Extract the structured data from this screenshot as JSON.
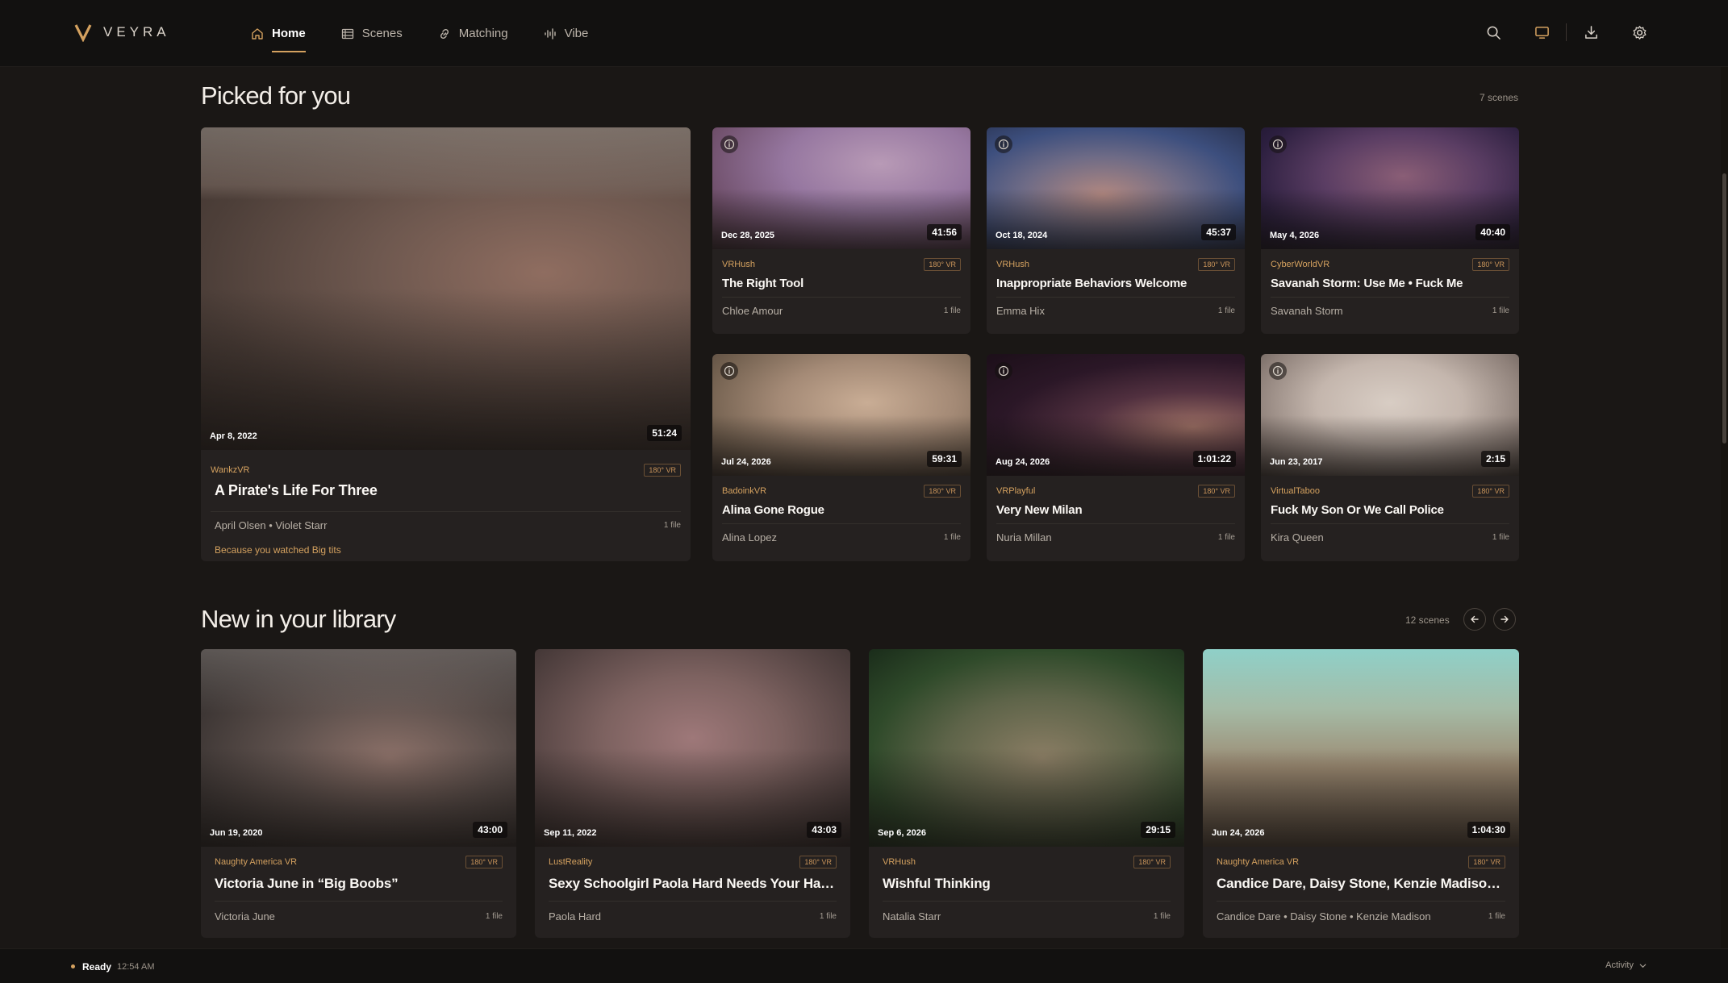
{
  "brand": {
    "name": "VEYRA",
    "accent": "#d4a15f"
  },
  "nav": [
    {
      "label": "Home",
      "icon": "home-icon",
      "active": true
    },
    {
      "label": "Scenes",
      "icon": "film-icon",
      "active": false
    },
    {
      "label": "Matching",
      "icon": "link-icon",
      "active": false
    },
    {
      "label": "Vibe",
      "icon": "waveform-icon",
      "active": false
    }
  ],
  "toolbar": [
    "search-icon",
    "monitor-icon",
    "download-icon",
    "gear-icon"
  ],
  "picked": {
    "title": "Picked for you",
    "count": "7 scenes",
    "featured": {
      "date": "Apr 8, 2022",
      "duration": "51:24",
      "studio": "WankzVR",
      "badge": "180° VR",
      "title": "A Pirate's Life For Three",
      "performers": "April Olsen • Violet Starr",
      "files": "1 file",
      "reason": "Because you watched Big tits"
    },
    "items": [
      {
        "date": "Dec 28, 2025",
        "duration": "41:56",
        "studio": "VRHush",
        "badge": "180° VR",
        "title": "The Right Tool",
        "performers": "Chloe Amour",
        "files": "1 file"
      },
      {
        "date": "Oct 18, 2024",
        "duration": "45:37",
        "studio": "VRHush",
        "badge": "180° VR",
        "title": "Inappropriate Behaviors Welcome",
        "performers": "Emma Hix",
        "files": "1 file"
      },
      {
        "date": "May 4, 2026",
        "duration": "40:40",
        "studio": "CyberWorldVR",
        "badge": "180° VR",
        "title": "Savanah Storm: Use Me • Fuck Me",
        "performers": "Savanah Storm",
        "files": "1 file"
      },
      {
        "date": "Jul 24, 2026",
        "duration": "59:31",
        "studio": "BadoinkVR",
        "badge": "180° VR",
        "title": "Alina Gone Rogue",
        "performers": "Alina Lopez",
        "files": "1 file"
      },
      {
        "date": "Aug 24, 2026",
        "duration": "1:01:22",
        "studio": "VRPlayful",
        "badge": "180° VR",
        "title": "Very New Milan",
        "performers": "Nuria Millan",
        "files": "1 file"
      },
      {
        "date": "Jun 23, 2017",
        "duration": "2:15",
        "studio": "VirtualTaboo",
        "badge": "180° VR",
        "title": "Fuck My Son Or We Call Police",
        "performers": "Kira Queen",
        "files": "1 file"
      }
    ]
  },
  "library": {
    "title": "New in your library",
    "count": "12 scenes",
    "items": [
      {
        "date": "Jun 19, 2020",
        "duration": "43:00",
        "studio": "Naughty America VR",
        "badge": "180° VR",
        "title": "Victoria June in “Big Boobs”",
        "performers": "Victoria June",
        "files": "1 file"
      },
      {
        "date": "Sep 11, 2022",
        "duration": "43:03",
        "studio": "LustReality",
        "badge": "180° VR",
        "title": "Sexy Schoolgirl Paola Hard Needs Your Hard ...",
        "performers": "Paola Hard",
        "files": "1 file"
      },
      {
        "date": "Sep 6, 2026",
        "duration": "29:15",
        "studio": "VRHush",
        "badge": "180° VR",
        "title": "Wishful Thinking",
        "performers": "Natalia Starr",
        "files": "1 file"
      },
      {
        "date": "Jun 24, 2026",
        "duration": "1:04:30",
        "studio": "Naughty America VR",
        "badge": "180° VR",
        "title": "Candice Dare, Daisy Stone, Kenzie Madison i...",
        "performers": "Candice Dare • Daisy Stone • Kenzie Madison",
        "files": "1 file"
      }
    ]
  },
  "status": {
    "text": "Ready",
    "time": "12:54 AM",
    "activity": "Activity"
  }
}
